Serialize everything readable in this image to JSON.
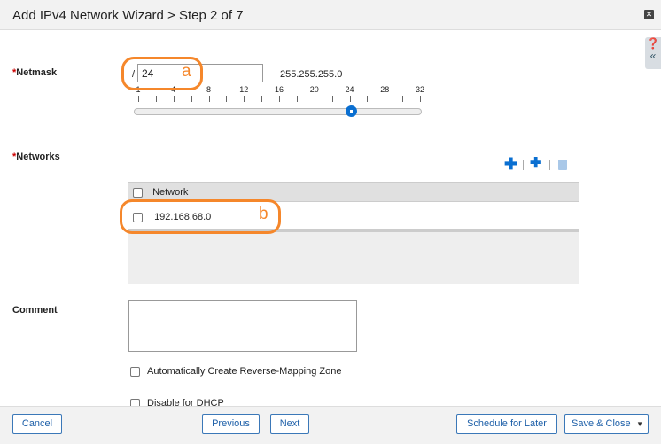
{
  "title": "Add IPv4 Network Wizard > Step 2 of 7",
  "netmask": {
    "label": "Netmask",
    "prefix": "/",
    "value": "24",
    "mask": "255.255.255.0",
    "slider_labels": [
      "1",
      "4",
      "8",
      "12",
      "16",
      "20",
      "24",
      "28",
      "32"
    ],
    "slider_value": 24,
    "slider_min": 1,
    "slider_max": 32
  },
  "networks": {
    "label": "Networks",
    "column": "Network",
    "rows": [
      "192.168.68.0"
    ]
  },
  "comment": {
    "label": "Comment",
    "value": ""
  },
  "checkboxes": [
    "Automatically Create Reverse-Mapping Zone",
    "Disable for DHCP"
  ],
  "annotations": [
    "a",
    "b"
  ],
  "footer": {
    "cancel": "Cancel",
    "previous": "Previous",
    "next": "Next",
    "schedule": "Schedule for Later",
    "save": "Save & Close"
  },
  "colors": {
    "accent": "#0a6fd1",
    "annotation": "#f5872b"
  }
}
